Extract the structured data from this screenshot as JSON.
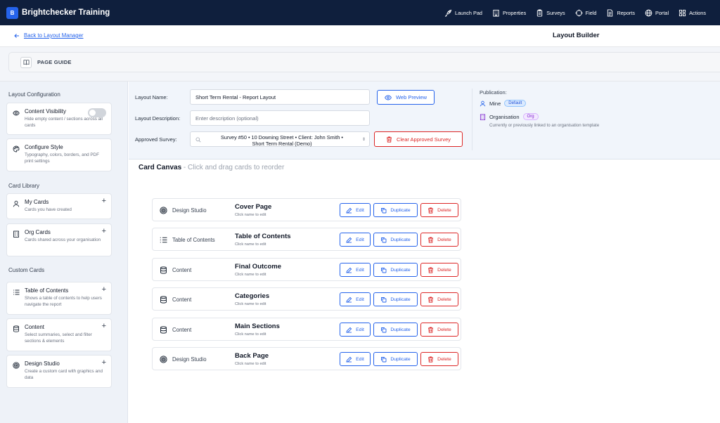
{
  "app": {
    "logo_letter": "B",
    "name": "Brightchecker Training"
  },
  "nav": [
    {
      "label": "Launch Pad",
      "icon": "rocket-icon"
    },
    {
      "label": "Properties",
      "icon": "building-icon"
    },
    {
      "label": "Surveys",
      "icon": "clipboard-icon"
    },
    {
      "label": "Field",
      "icon": "crosshair-icon"
    },
    {
      "label": "Reports",
      "icon": "file-icon"
    },
    {
      "label": "Portal",
      "icon": "globe-icon"
    },
    {
      "label": "Actions",
      "icon": "grid-icon"
    }
  ],
  "header": {
    "back_label": "Back to Layout Manager",
    "title": "Layout Builder"
  },
  "guide": {
    "label": "PAGE GUIDE"
  },
  "sidebar": {
    "layout_config_title": "Layout Configuration",
    "content_visibility": {
      "title": "Content Visibility",
      "desc": "Hide empty content / sections across all cards",
      "enabled": false
    },
    "configure_style": {
      "title": "Configure Style",
      "desc": "Typography, colors, borders, and PDF print settings"
    },
    "card_library_title": "Card Library",
    "my_cards": {
      "title": "My Cards",
      "desc": "Cards you have created"
    },
    "org_cards": {
      "title": "Org Cards",
      "desc": "Cards shared across your organisation"
    },
    "custom_cards_title": "Custom Cards",
    "toc": {
      "title": "Table of Contents",
      "desc": "Shows a table of contents to help users navigate the report"
    },
    "content": {
      "title": "Content",
      "desc": "Select summaries, select and filter sections & elements"
    },
    "design_studio": {
      "title": "Design Studio",
      "desc": "Create a custom card with graphics and data"
    },
    "plus": "+"
  },
  "config": {
    "name_label": "Layout Name:",
    "name_value": "Short Term Rental - Report Layout",
    "desc_label": "Layout Description:",
    "desc_placeholder": "Enter description (optional)",
    "survey_label": "Approved Survey:",
    "survey_value_line1": "Survey #50 • 10 Downing Street • Client: John Smith •",
    "survey_value_line2": "Short Term Rental (Demo)",
    "web_preview": "Web Preview",
    "clear_survey": "Clear Approved Survey"
  },
  "publication": {
    "title": "Publication:",
    "mine_label": "Mine",
    "mine_badge": "Default",
    "org_label": "Organisation",
    "org_badge": "Org",
    "note": "Currently or previously linked to an organisation template"
  },
  "canvas": {
    "title": "Card Canvas",
    "hint": " - Click and drag cards to reorder",
    "click_hint": "Click name to edit",
    "edit": "Edit",
    "duplicate": "Duplicate",
    "delete": "Delete",
    "cards": [
      {
        "type": "Design Studio",
        "icon": "target-icon",
        "name": "Cover Page"
      },
      {
        "type": "Table of Contents",
        "icon": "list-icon",
        "name": "Table of Contents"
      },
      {
        "type": "Content",
        "icon": "database-icon",
        "name": "Final Outcome"
      },
      {
        "type": "Content",
        "icon": "database-icon",
        "name": "Categories"
      },
      {
        "type": "Content",
        "icon": "database-icon",
        "name": "Main Sections"
      },
      {
        "type": "Design Studio",
        "icon": "target-icon",
        "name": "Back Page"
      }
    ]
  },
  "colors": {
    "nav_bg": "#0f1f3d",
    "accent": "#2563eb",
    "danger": "#dc2626",
    "sidebar_bg": "#eef2f8",
    "purple": "#7e22ce"
  }
}
